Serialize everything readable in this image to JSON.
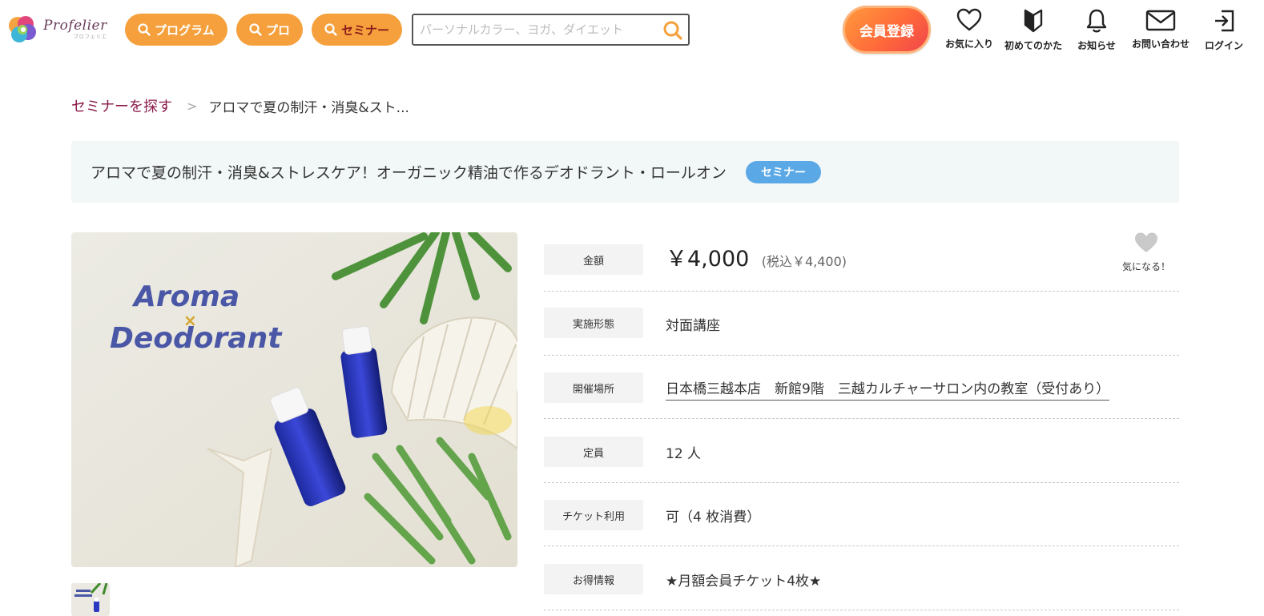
{
  "header": {
    "logo_text": "Profelier",
    "logo_sub": "プロフェリエ",
    "nav": [
      {
        "label": "プログラム"
      },
      {
        "label": "プロ"
      },
      {
        "label": "セミナー"
      }
    ],
    "search": {
      "placeholder": "パーソナルカラー、ヨガ、ダイエット",
      "value": ""
    },
    "register_label": "会員登録",
    "icons": [
      {
        "label": "お気に入り",
        "icon": "heart-icon"
      },
      {
        "label": "初めてのかた",
        "icon": "beginner-mark-icon"
      },
      {
        "label": "お知らせ",
        "icon": "bell-icon"
      },
      {
        "label": "お問い合わせ",
        "icon": "mail-icon"
      },
      {
        "label": "ログイン",
        "icon": "login-icon"
      }
    ]
  },
  "breadcrumb": {
    "parent": "セミナーを探す",
    "separator": ">",
    "current": "アロマで夏の制汗・消臭&スト..."
  },
  "title": {
    "text": "アロマで夏の制汗・消臭&ストレスケア！オーガニック精油で作るデオドラント・ロールオン",
    "badge": "セミナー"
  },
  "image": {
    "text_line1": "Aroma",
    "text_cross": "×",
    "text_line2": "Deodorant"
  },
  "favorite": {
    "label": "気になる！"
  },
  "info": {
    "price": {
      "label": "金額",
      "main": "￥4,000",
      "tax": "(税込￥4,400)"
    },
    "format": {
      "label": "実施形態",
      "value": "対面講座"
    },
    "venue": {
      "label": "開催場所",
      "value": "日本橋三越本店　新館9階　三越カルチャーサロン内の教室（受付あり）"
    },
    "capacity": {
      "label": "定員",
      "value": "12 人"
    },
    "ticket": {
      "label": "チケット利用",
      "value": "可（4 枚消費）"
    },
    "deal": {
      "label": "お得情報",
      "value": "★月額会員チケット4枚★"
    }
  },
  "colors": {
    "nav_pill": "#f5a03c",
    "breadcrumb_link": "#8a1c4a",
    "badge": "#5aa9e6",
    "title_bg": "#f2f7f7"
  }
}
